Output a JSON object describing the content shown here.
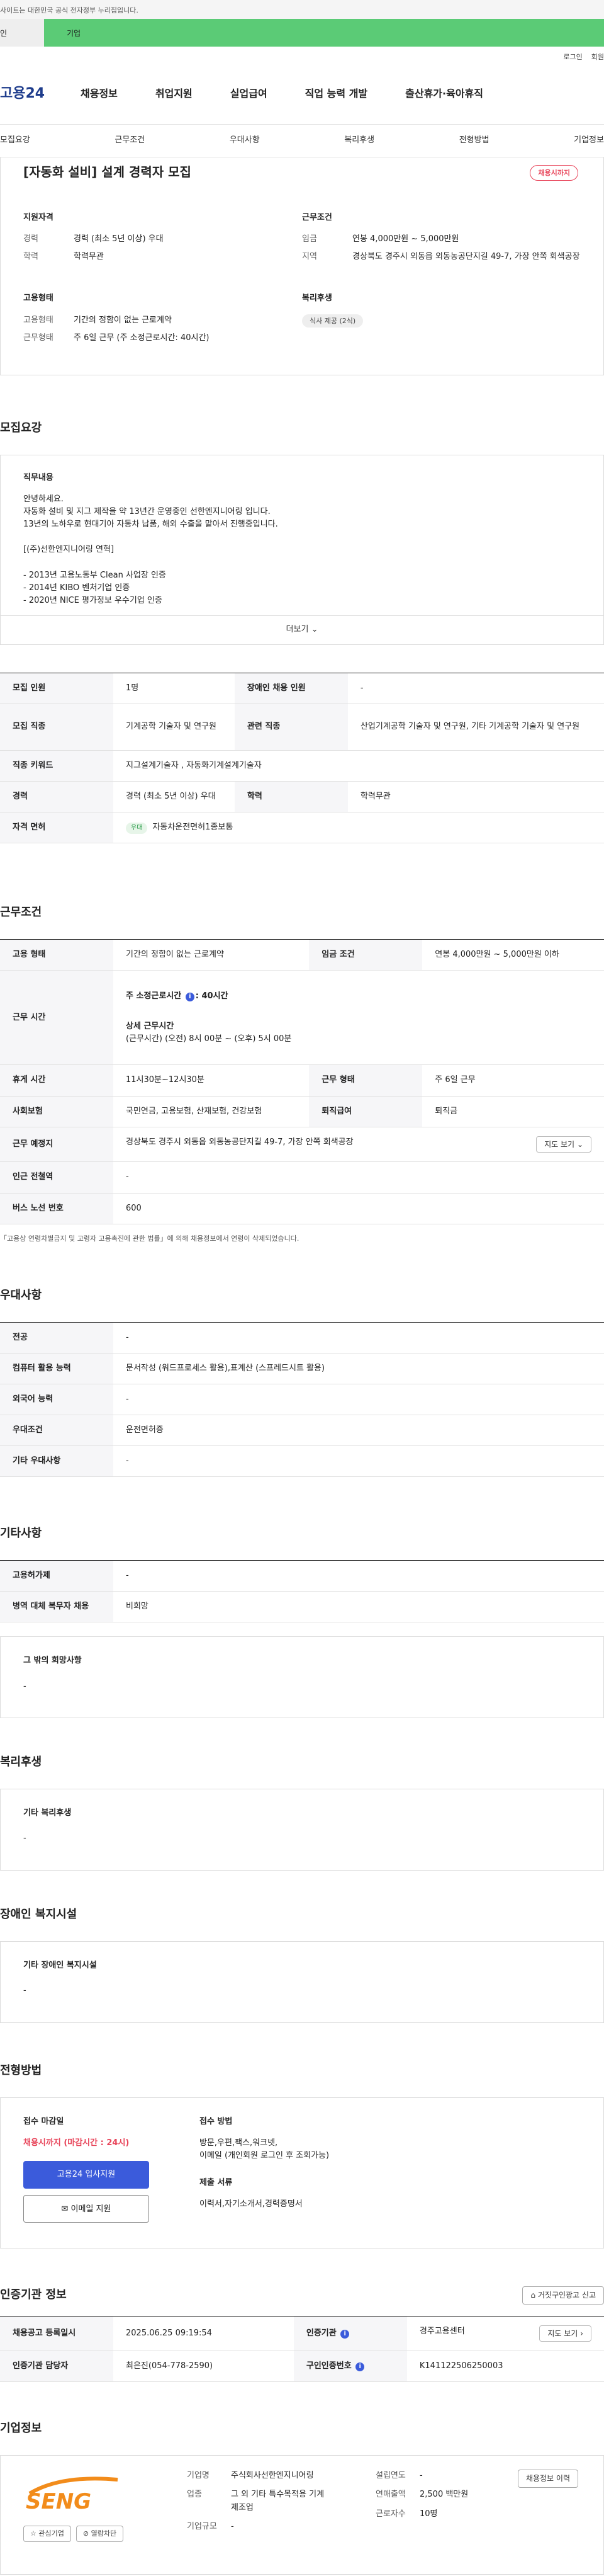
{
  "gov": {
    "strip": "사이트는 대한민국 공식 전자정부 누리집입니다."
  },
  "tabs": {
    "person": "인",
    "company": "기업"
  },
  "util": {
    "login": "로그인",
    "signup": "회원"
  },
  "brand": {
    "logo": "고용24"
  },
  "gnb": [
    "채용정보",
    "취업지원",
    "실업급여",
    "직업 능력 개발",
    "출산휴가·육아휴직"
  ],
  "anchors": [
    "모집요강",
    "근무조건",
    "우대사항",
    "복리후생",
    "전형방법",
    "기업정보"
  ],
  "summary": {
    "title": "[자동화 설비] 설계 경력자 모집",
    "status": "채용시까지",
    "qual_head": "지원자격",
    "qual": [
      {
        "k": "경력",
        "v": "경력 (최소 5년 이상) 우대"
      },
      {
        "k": "학력",
        "v": "학력무관"
      }
    ],
    "cond_head": "근무조건",
    "cond": [
      {
        "k": "임금",
        "v": "연봉 4,000만원 ~ 5,000만원"
      },
      {
        "k": "지역",
        "v": "경상북도 경주시 외동읍 외동농공단지길 49-7, 가장 안쪽 회색공장"
      }
    ],
    "emp_head": "고용형태",
    "emp": [
      {
        "k": "고용형태",
        "v": "기간의 정함이 없는 근로계약"
      },
      {
        "k": "근무형태",
        "v": "주 6일 근무 (주 소정근로시간: 40시간)"
      }
    ],
    "welfare_head": "복리후생",
    "welfare_badge": "식사 제공 (2식)"
  },
  "recruit": {
    "section": "모집요강",
    "job_head": "직무내용",
    "lines": [
      "안녕하세요.",
      "자동화 설비 및 지그 제작을 약 13년간 운영중인 선한엔지니어링 입니다.",
      "13년의 노하우로 현대기아 자동차 납품, 해외 수출을 맡아서 진행중입니다.",
      "",
      "[(주)선한엔지니어링 연혁]",
      "",
      "- 2013년 고용노동부 Clean 사업장 인증",
      "- 2014년 KIBO 벤처기업 인증",
      "- 2020년 NICE 평가정보 우수기업 인증"
    ],
    "more": "더보기",
    "table": {
      "headcount_k": "모집 인원",
      "headcount_v": "1명",
      "disabled_k": "장애인 채용 인원",
      "disabled_v": "-",
      "job_k": "모집 직종",
      "job_v": "기계공학 기술자 및 연구원",
      "related_k": "관련 직종",
      "related_v": "산업기계공학 기술자 및 연구원, 기타 기계공학 기술자 및 연구원",
      "keyword_k": "직종 키워드",
      "keyword_v": "지그설계기술자 , 자동화기계설계기술자",
      "career_k": "경력",
      "career_v": "경력 (최소 5년 이상) 우대",
      "edu_k": "학력",
      "edu_v": "학력무관",
      "license_k": "자격 면허",
      "license_chip": "우대",
      "license_v": "자동차운전면허1종보통"
    }
  },
  "work": {
    "section": "근무조건",
    "emp_k": "고용 형태",
    "emp_v": "기간의 정함이 없는 근로계약",
    "wage_k": "임금 조건",
    "wage_v": "연봉 4,000만원 ~ 5,000만원 이하",
    "time_k": "근무 시간",
    "time_label": "주 소정근로시간",
    "time_info": "i",
    "time_hours": ": 40시간",
    "time_detail_head": "상세 근무시간",
    "time_detail": "(근무시간) (오전) 8시 00분 ~ (오후) 5시 00분",
    "break_k": "휴게 시간",
    "break_v": "11시30분~12시30분",
    "form_k": "근무 형태",
    "form_v": "주 6일 근무",
    "insurance_k": "사회보험",
    "insurance_v": "국민연금, 고용보험, 산재보험, 건강보험",
    "retire_k": "퇴직급여",
    "retire_v": "퇴직금",
    "place_k": "근무 예정지",
    "place_v": "경상북도 경주시 외동읍 외동농공단지길 49-7, 가장 안쪽 회색공장",
    "map_btn": "지도 보기",
    "subway_k": "인근 전철역",
    "subway_v": "-",
    "bus_k": "버스 노선 번호",
    "bus_v": "600",
    "note": "「고용상 연령차별금지 및 고령자 고용촉진에 관한 법률」에 의해 채용정보에서 연령이 삭제되었습니다."
  },
  "pref": {
    "section": "우대사항",
    "rows": [
      {
        "k": "전공",
        "v": "-"
      },
      {
        "k": "컴퓨터 활용 능력",
        "v": "문서작성 (워드프로세스 활용),표계산 (스프레드시트 활용)"
      },
      {
        "k": "외국어 능력",
        "v": "-"
      },
      {
        "k": "우대조건",
        "v": "운전면허증"
      },
      {
        "k": "기타 우대사항",
        "v": "-"
      }
    ]
  },
  "etc": {
    "section": "기타사항",
    "rows": [
      {
        "k": "고용허가제",
        "v": "-"
      },
      {
        "k": "병역 대체 복무자 채용",
        "v": "비희망"
      }
    ],
    "other_head": "그 밖의 희망사항",
    "other_v": "-"
  },
  "welfare": {
    "section": "복리후생",
    "head": "기타 복리후생",
    "v": "-"
  },
  "disabled": {
    "section": "장애인 복지시설",
    "head": "기타 장애인 복지시설",
    "v": "-"
  },
  "apply": {
    "section": "전형방법",
    "deadline_head": "접수 마감일",
    "deadline": "채용시까지 (마감시간 : 24시)",
    "apply_btn": "고용24 입사지원",
    "email_btn": "이메일 지원",
    "method_head": "접수 방법",
    "method_l1": "방문,우편,팩스,워크넷,",
    "method_l2": "이메일 (개인회원 로그인 후 조회가능)",
    "docs_head": "제출 서류",
    "docs": "이력서,자기소개서,경력증명서"
  },
  "cert": {
    "section": "인증기관 정보",
    "report_btn": "거짓구인광고 신고",
    "reg_k": "채용공고 등록일시",
    "reg_v": "2025.06.25 09:19:54",
    "org_k": "인증기관",
    "org_v": "경주고용센터",
    "map_btn": "지도 보기",
    "mgr_k": "인증기관 담당자",
    "mgr_v": "최은진(054-778-2590)",
    "no_k": "구인인증번호",
    "no_v": "K141122506250003"
  },
  "company": {
    "section": "기업정보",
    "logo_text": "SENG",
    "fav_btn": "관심기업",
    "block_btn": "열람차단",
    "name_k": "기업명",
    "name_v": "주식회사선한엔지니어링",
    "biz_k": "업종",
    "biz_v": "그 외 기타 특수목적용 기계 제조업",
    "size_k": "기업규모",
    "size_v": "-",
    "est_k": "설립연도",
    "est_v": "-",
    "sales_k": "연매출액",
    "sales_v": "2,500 백만원",
    "emp_k": "근로자수",
    "emp_v": "10명",
    "info_btn": "채용정보 이력"
  },
  "colors": {
    "accent": "#3b5bdb",
    "brand_green": "#5bcb76",
    "status_red": "#e8455a"
  }
}
